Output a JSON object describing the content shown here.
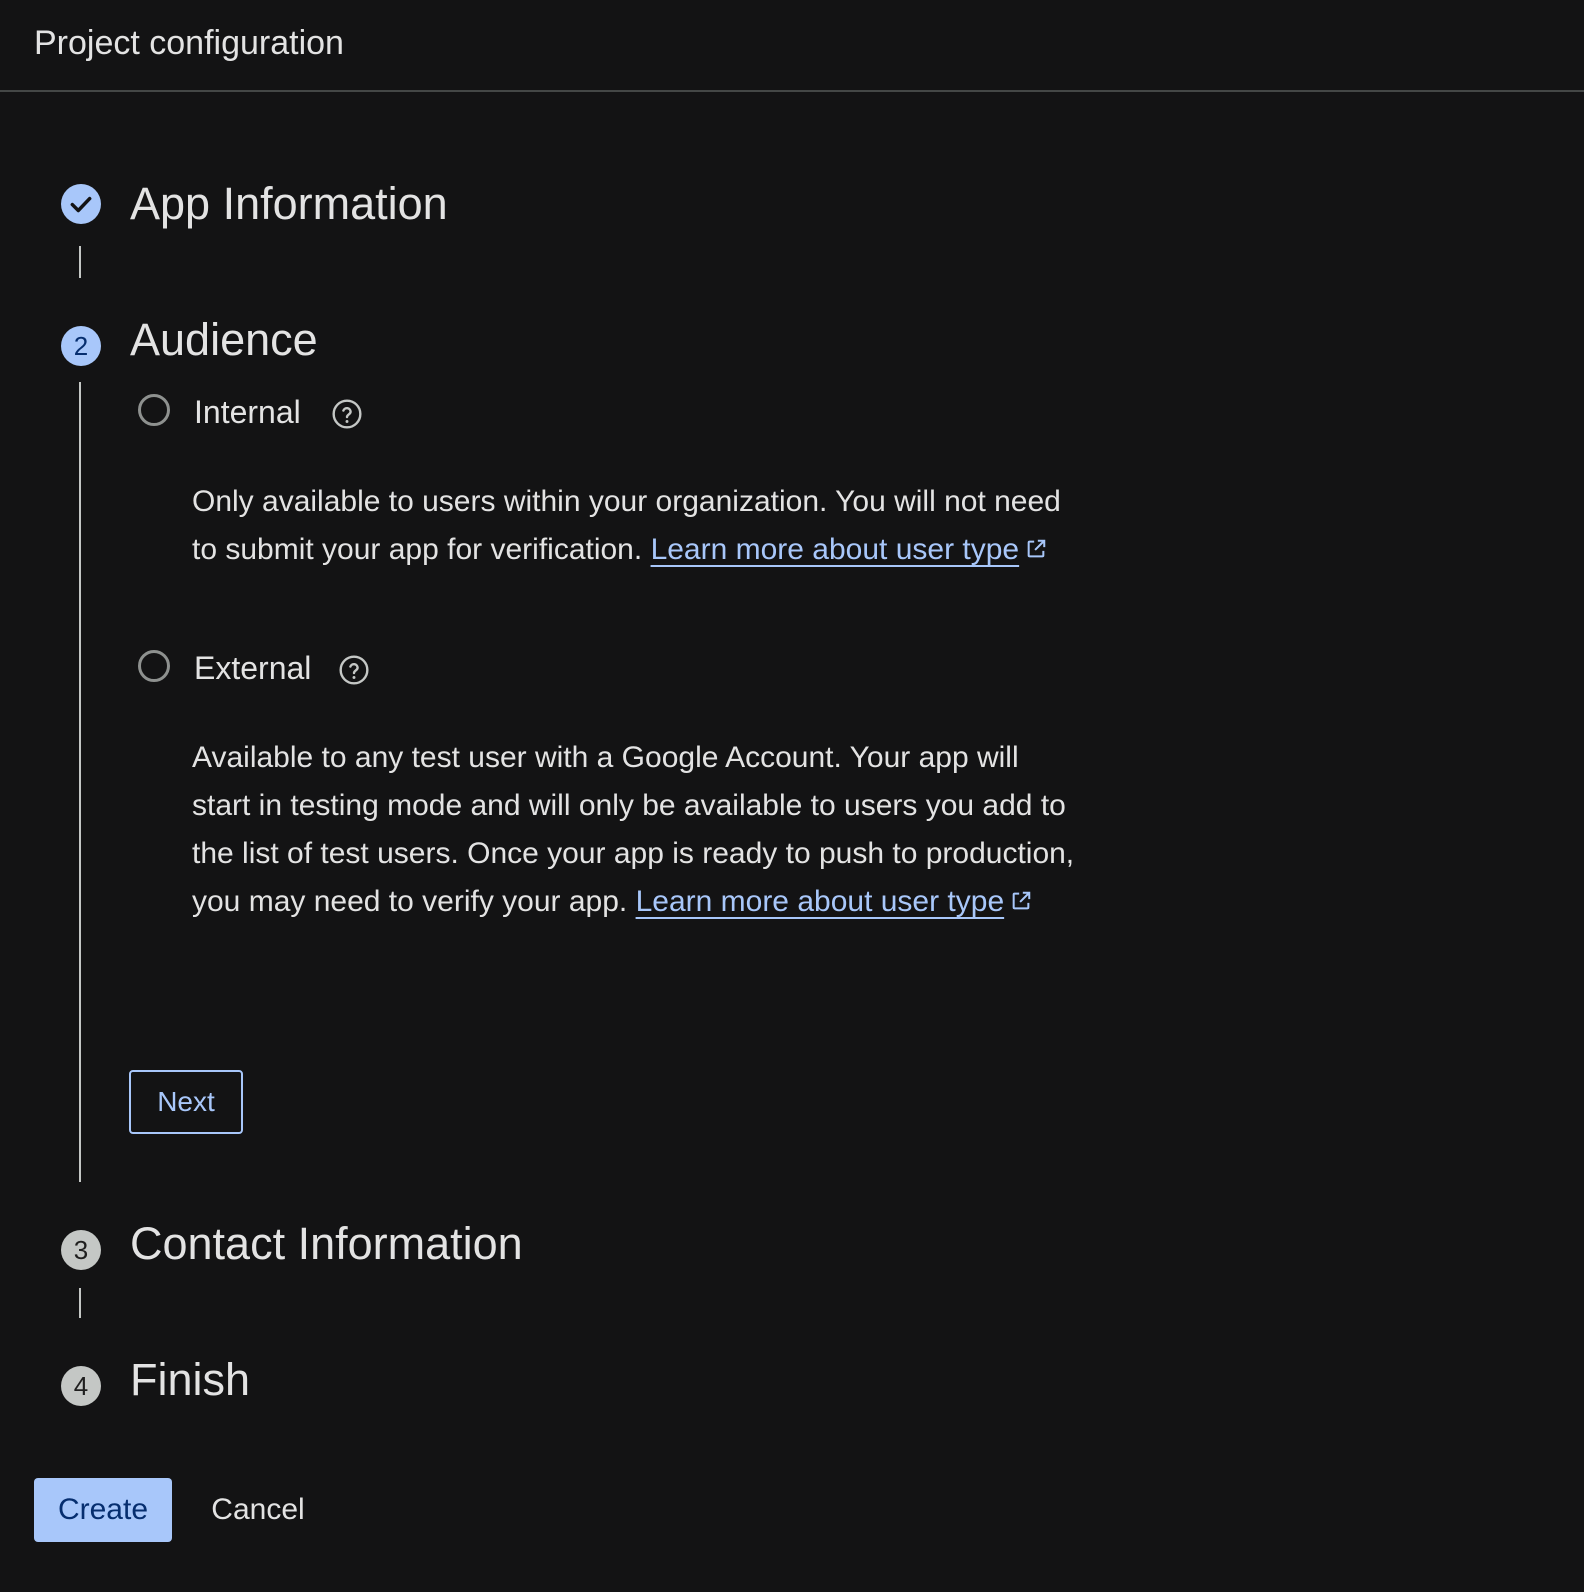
{
  "header": {
    "title": "Project configuration"
  },
  "steps": [
    {
      "number": "",
      "title": "App Information",
      "state": "done",
      "icon": "check-icon"
    },
    {
      "number": "2",
      "title": "Audience",
      "state": "active"
    },
    {
      "number": "3",
      "title": "Contact Information",
      "state": "pending"
    },
    {
      "number": "4",
      "title": "Finish",
      "state": "pending"
    }
  ],
  "audience": {
    "options": [
      {
        "label": "Internal",
        "selected": false,
        "help_icon": "help-circle-icon",
        "description": "Only available to users within your organization. You will not need to submit your app for verification.",
        "link_text": "Learn more about user type",
        "link_icon": "open-in-new-icon"
      },
      {
        "label": "External",
        "selected": false,
        "help_icon": "help-circle-icon",
        "description": "Available to any test user with a Google Account. Your app will start in testing mode and will only be available to users you add to the list of test users. Once your app is ready to push to production, you may need to verify your app.",
        "link_text": "Learn more about user type",
        "link_icon": "open-in-new-icon"
      }
    ],
    "next_label": "Next"
  },
  "footer": {
    "create_label": "Create",
    "cancel_label": "Cancel"
  },
  "colors": {
    "background": "#131314",
    "accent": "#a8c7fa",
    "text": "#e3e3e3",
    "pending_step": "#c4c7c5"
  }
}
